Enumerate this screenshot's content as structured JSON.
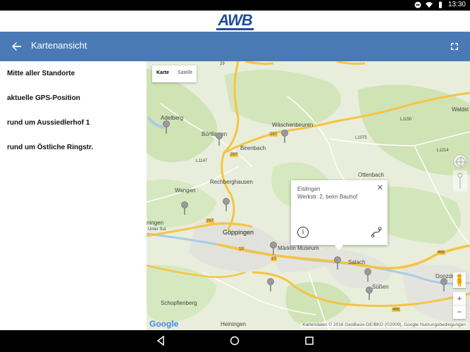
{
  "status_bar": {
    "time": "13:30"
  },
  "logo": {
    "text": "AWB"
  },
  "app_bar": {
    "title": "Kartenansicht"
  },
  "sidebar": {
    "items": [
      {
        "label": "Mitte aller Standorte"
      },
      {
        "label": "aktuelle GPS-Position"
      },
      {
        "label": "rund um Aussiedlerhof 1"
      },
      {
        "label": "rund um Östliche  Ringstr."
      }
    ]
  },
  "map": {
    "map_type": {
      "karte": "Karte",
      "satellit": "Satellit"
    },
    "places": {
      "adelberg": "Adelberg",
      "borthlingen": "Börtlingen",
      "waeschenbeuren": "Wäschenbeuren",
      "waldstetten": "Waldst",
      "birenbach": "Birenbach",
      "ottenbach": "Ottenbach",
      "rechberghausen": "Rechberghausen",
      "wangen": "Wangen",
      "eislingen_map": "Eislingen",
      "goeppingen": "Göppingen",
      "maerklin": "Märklin Museum",
      "salach": "Salach",
      "suessen": "Süßen",
      "donzdorf": "Donzdorf",
      "schopflenberg": "Schopflenberg",
      "heiningen": "Heiningen",
      "ningen": "ningen",
      "unter_sut": "Unter Sut"
    },
    "roads": {
      "r29": "29",
      "r297a": "297",
      "r297b": "297",
      "r297c": "297",
      "r10a": "10",
      "r10b": "10",
      "r466": "466",
      "r466b": "466",
      "l1075": "L1075",
      "l1150": "L1150",
      "l1147": "L1147",
      "l1214": "L1214"
    },
    "info_window": {
      "title": "Eislingen",
      "subtitle": "Werkstr. 2, beim Bauhof"
    },
    "google_logo": "Google",
    "copyright": "Kartendaten © 2016 GeoBasis-DE/BKG (©2009), Google  Nutzungsbedingungen"
  },
  "colors": {
    "app_bar": "#4a7ab5",
    "logo": "#1d4e9a",
    "map_bg": "#e8eedb",
    "road_major": "#f6c343"
  }
}
